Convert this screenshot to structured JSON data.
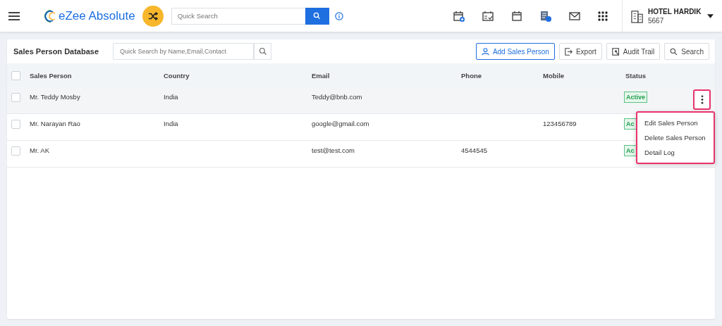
{
  "topbar": {
    "brand": "eZee Absolute",
    "search": {
      "placeholder": "Quick Search"
    },
    "hotel": {
      "name": "HOTEL HARDIK",
      "code": "5667"
    }
  },
  "panel": {
    "title": "Sales Person Database",
    "search": {
      "placeholder": "Quick Search by Name,Email,Contact"
    },
    "buttons": [
      {
        "label": "Add Sales Person",
        "kind": "add",
        "primary": true
      },
      {
        "label": "Export",
        "kind": "export",
        "primary": false
      },
      {
        "label": "Audit Trail",
        "kind": "audit",
        "primary": false
      },
      {
        "label": "Search",
        "kind": "search",
        "primary": false
      }
    ]
  },
  "table": {
    "select_all_checked": false,
    "columns": [
      "Sales Person",
      "Country",
      "Email",
      "Phone",
      "Mobile",
      "Status"
    ],
    "rows": [
      {
        "checked": false,
        "hovered": true,
        "cells": [
          "Mr. Teddy Mosby",
          "India",
          "Teddy@bnb.com",
          "",
          "",
          "Active"
        ],
        "menu_button": true
      },
      {
        "checked": false,
        "hovered": false,
        "cells": [
          "Mr. Narayan Rao",
          "India",
          "google@gmail.com",
          "",
          "123456789",
          "Ac"
        ],
        "menu_button": false
      },
      {
        "checked": false,
        "hovered": false,
        "cells": [
          "Mr. AK",
          "",
          "test@test.com",
          "4544545",
          "",
          "Ac"
        ],
        "menu_button": false
      }
    ]
  },
  "context_menu": {
    "highlighted": true,
    "items": [
      "Edit Sales Person",
      "Delete Sales Person",
      "Detail Log"
    ]
  }
}
